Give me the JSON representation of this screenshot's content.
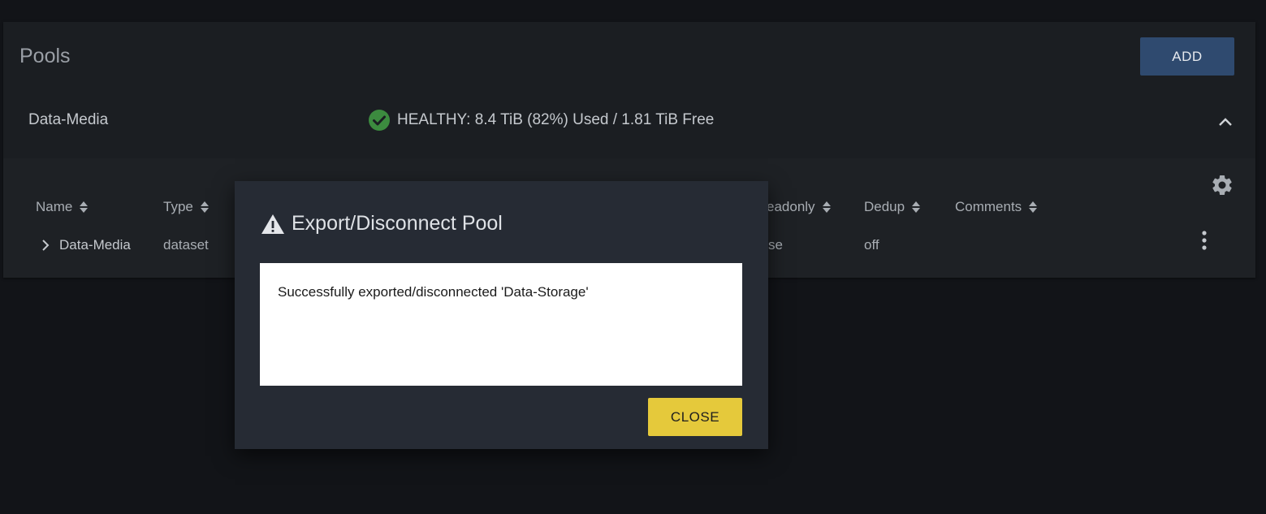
{
  "header": {
    "title": "Pools",
    "add_label": "ADD"
  },
  "pool": {
    "name": "Data-Media",
    "status": "HEALTHY: 8.4 TiB (82%) Used / 1.81 TiB Free",
    "status_color": "#3c8b3f"
  },
  "table": {
    "columns": [
      "Name",
      "Type",
      "eadonly",
      "Dedup",
      "Comments"
    ],
    "row": {
      "name": "Data-Media",
      "type": "dataset",
      "readonly": "se",
      "dedup": "off"
    }
  },
  "dialog": {
    "title": "Export/Disconnect Pool",
    "message": "Successfully exported/disconnected 'Data-Storage'",
    "close_label": "CLOSE"
  },
  "colors": {
    "accent": "#2f4a6f",
    "close_button": "#e5c93b",
    "background": "#121418"
  },
  "icons": [
    "check-circle-icon",
    "chevron-up-icon",
    "gear-icon",
    "sort-icon",
    "chevron-right-icon",
    "more-vert-icon",
    "warning-icon"
  ]
}
